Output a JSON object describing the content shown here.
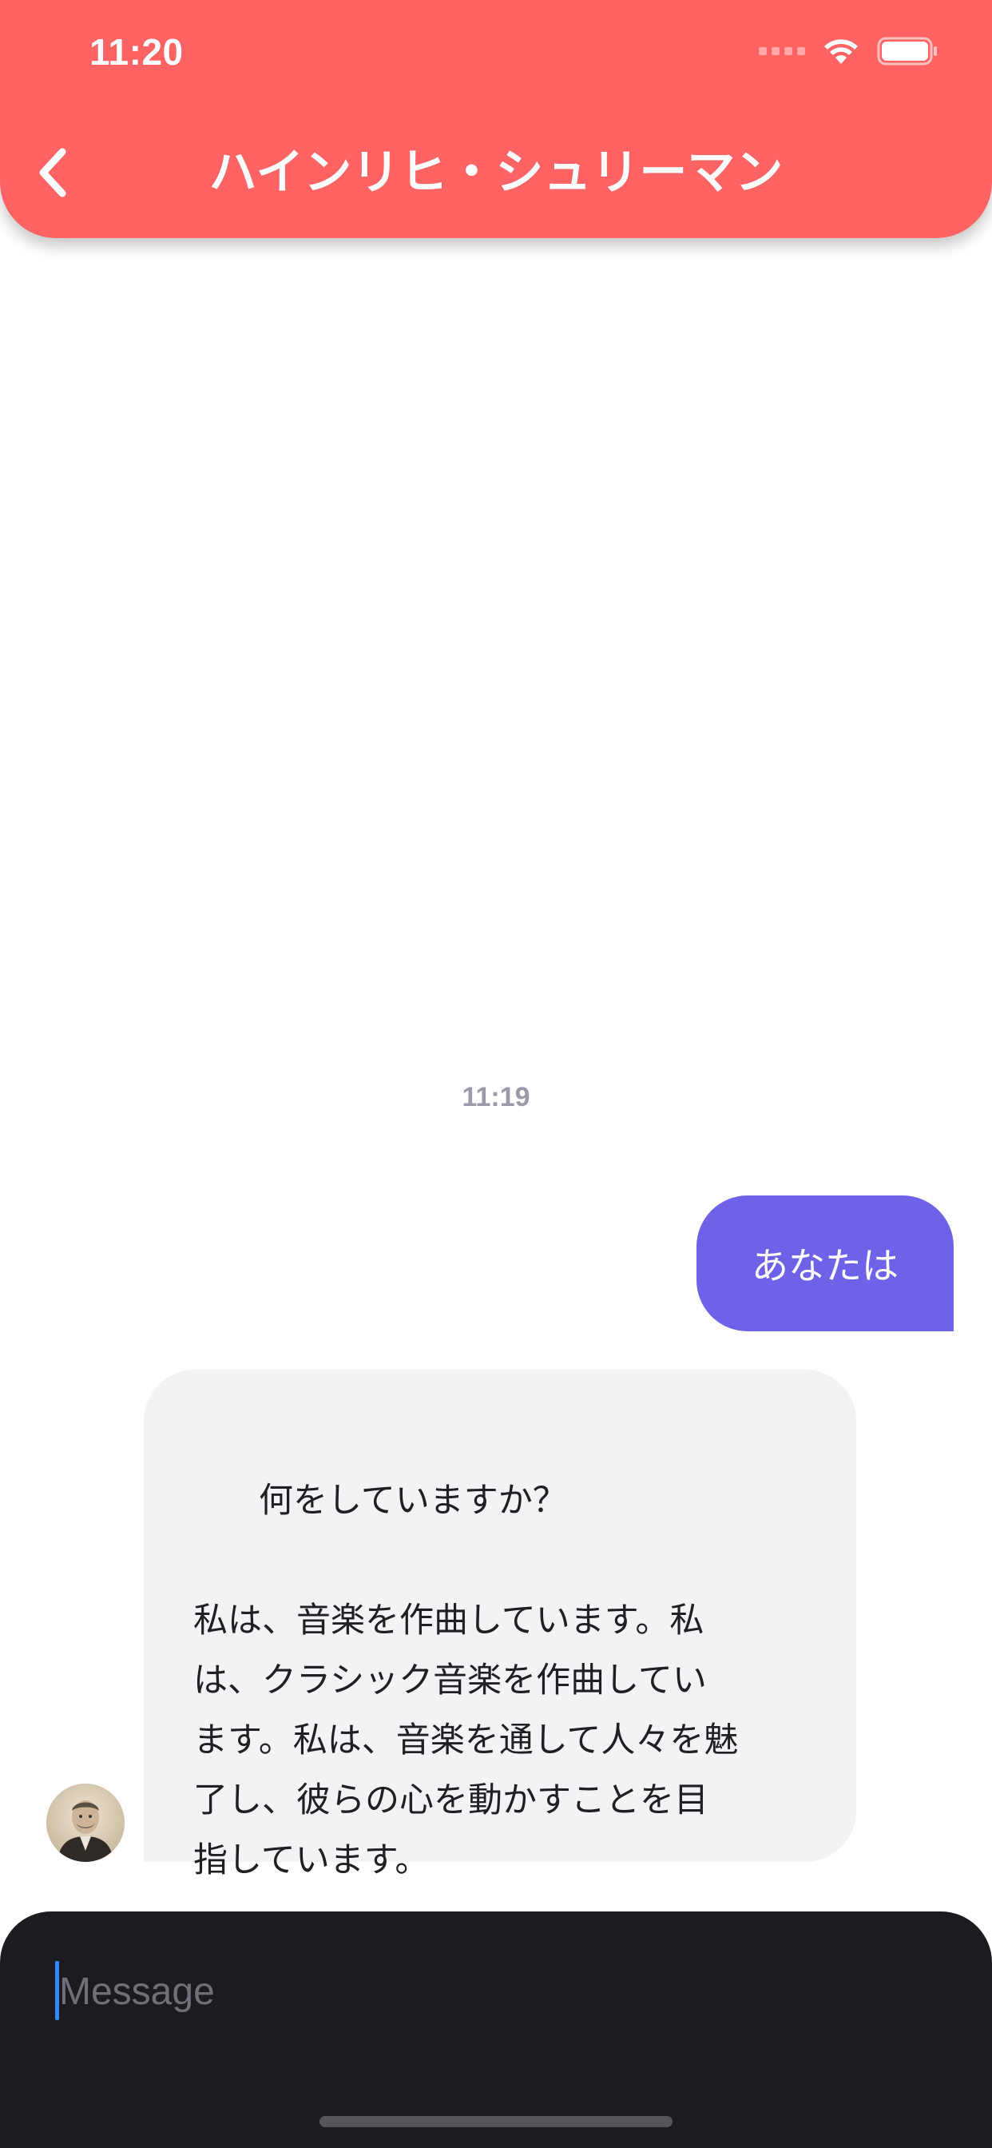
{
  "status_bar": {
    "time": "11:20",
    "icons": [
      "signal-icon",
      "wifi-icon",
      "battery-icon"
    ]
  },
  "header": {
    "title": "ハインリヒ・シュリーマン",
    "back_icon": "chevron-left-icon",
    "color": "#FF6363"
  },
  "chat": {
    "timestamp": "11:19",
    "messages": [
      {
        "sender": "user",
        "text": "あなたは",
        "color": "#6E63E8"
      },
      {
        "sender": "character",
        "text": "何をしていますか？\n\n私は、音楽を作曲しています。私\nは、クラシック音楽を作曲してい\nます。私は、音楽を通して人々を魅\n了し、彼らの心を動かすことを目\n指しています。",
        "color": "#F3F3F6",
        "avatar": "character-avatar"
      }
    ]
  },
  "composer": {
    "placeholder": "Message",
    "value": "",
    "background": "#1C1B20"
  }
}
